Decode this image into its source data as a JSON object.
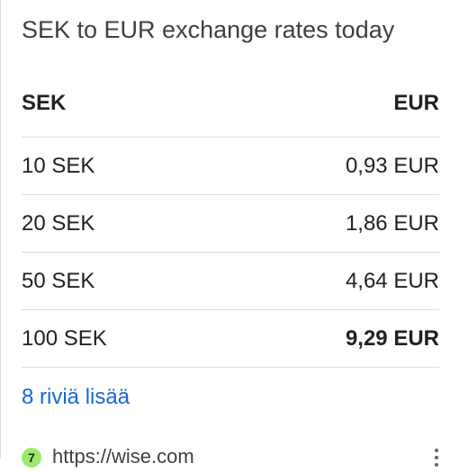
{
  "card": {
    "title": "SEK to EUR exchange rates today"
  },
  "table": {
    "headers": {
      "left": "SEK",
      "right": "EUR"
    },
    "rows": [
      {
        "left": "10 SEK",
        "right": "0,93 EUR"
      },
      {
        "left": "20 SEK",
        "right": "1,86 EUR"
      },
      {
        "left": "50 SEK",
        "right": "4,64 EUR"
      },
      {
        "left": "100 SEK",
        "right": "9,29 EUR"
      }
    ]
  },
  "more_link": "8 riviä lisää",
  "source": {
    "url": "https://wise.com",
    "favicon_glyph": "7",
    "favicon_color": "#9fe870"
  },
  "icons": {
    "more_options": "kebab-menu-icon"
  }
}
